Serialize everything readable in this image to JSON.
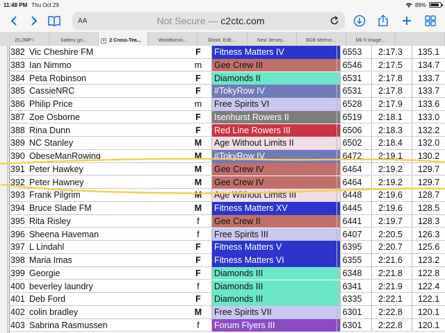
{
  "status_bar": {
    "time": "11:48 PM",
    "date": "Thu Oct 29",
    "battery": "89%",
    "battery_level": 0.89
  },
  "toolbar": {
    "aa_label": "AA",
    "not_secure": "Not Secure —",
    "domain": "c2ctc.com"
  },
  "tabs": [
    {
      "label": "20.2MP I",
      "active": false
    },
    {
      "label": "battery gri...",
      "active": false
    },
    {
      "label": "2 Cross-Tea...",
      "active": true
    },
    {
      "label": "Woodturnin...",
      "active": false
    },
    {
      "label": "Shoot, Edit,...",
      "active": false
    },
    {
      "label": "New Jersey...",
      "active": false
    },
    {
      "label": "8GB Memor...",
      "active": false
    },
    {
      "label": "Mk II Image...",
      "active": false
    },
    {
      "label": "",
      "active": false
    }
  ],
  "colors": {
    "blue": "#2b35cc",
    "rose": "#c0706a",
    "teal": "#6be6c8",
    "slate": "#6f7ab8",
    "lavender": "#c8c8f0",
    "gray": "#7d7d7d",
    "red": "#cc3344",
    "pink": "#f0dde6",
    "purple": "#8a4cc4",
    "highlight": "#f2cf52"
  },
  "results": [
    {
      "pos": "382",
      "name": "Vic Cheshire FM",
      "gender": "F",
      "club": "Fitness Matters IV",
      "club_color": "#2b35cc",
      "club_text": "#ffffff",
      "score": "6553",
      "time": "2:17.3",
      "split": "135.1"
    },
    {
      "pos": "383",
      "name": "Ian Nimmo",
      "gender": "m",
      "club": "Gee Crew III",
      "club_color": "#c0706a",
      "club_text": "#111111",
      "score": "6546",
      "time": "2:17.5",
      "split": "134.7"
    },
    {
      "pos": "384",
      "name": "Peta Robinson",
      "gender": "F",
      "club": "Diamonds II",
      "club_color": "#6be6c8",
      "club_text": "#111111",
      "score": "6531",
      "time": "2:17.8",
      "split": "133.7"
    },
    {
      "pos": "385",
      "name": "CassieNRC",
      "gender": "F",
      "club": "#TokyRow IV",
      "club_color": "#6f7ab8",
      "club_text": "#ffffff",
      "score": "6531",
      "time": "2:17.8",
      "split": "133.7"
    },
    {
      "pos": "386",
      "name": "Philip Price",
      "gender": "m",
      "club": "Free Spirits VI",
      "club_color": "#c8c8f0",
      "club_text": "#111111",
      "score": "6528",
      "time": "2:17.9",
      "split": "133.6"
    },
    {
      "pos": "387",
      "name": "Zoe Osborne",
      "gender": "F",
      "club": "Isenhurst Rowers II",
      "club_color": "#7d7d7d",
      "club_text": "#ffffff",
      "score": "6519",
      "time": "2:18.1",
      "split": "133.0"
    },
    {
      "pos": "388",
      "name": "Rina Dunn",
      "gender": "F",
      "club": "Red Line Rowers III",
      "club_color": "#cc3344",
      "club_text": "#ffffff",
      "score": "6506",
      "time": "2:18.3",
      "split": "132.2"
    },
    {
      "pos": "389",
      "name": "NC Stanley",
      "gender": "M",
      "club": "Age Without Limits II",
      "club_color": "#f0dde6",
      "club_text": "#111111",
      "score": "6502",
      "time": "2:18.4",
      "split": "132.0"
    },
    {
      "pos": "390",
      "name": "ObeseManRowing",
      "gender": "M",
      "club": "#TokyRow IV",
      "club_color": "#6f7ab8",
      "club_text": "#ffffff",
      "score": "6472",
      "time": "2:19.1",
      "split": "130.2"
    },
    {
      "pos": "391",
      "name": "Peter Hawkey",
      "gender": "M",
      "club": "Gee Crew IV",
      "club_color": "#c0706a",
      "club_text": "#111111",
      "score": "6464",
      "time": "2:19.2",
      "split": "129.7"
    },
    {
      "pos": "392",
      "name": "Peter Hawney",
      "gender": "M",
      "club": "Gee Crew IV",
      "club_color": "#c0706a",
      "club_text": "#111111",
      "score": "6464",
      "time": "2:19.2",
      "split": "129.7"
    },
    {
      "pos": "393",
      "name": "Frank Pilgrim",
      "gender": "M",
      "club": "Age Without Limits III",
      "club_color": "#f0dde6",
      "club_text": "#111111",
      "score": "6448",
      "time": "2:19.6",
      "split": "128.7"
    },
    {
      "pos": "394",
      "name": "Bruce Slade FM",
      "gender": "M",
      "club": "Fitness Matters XV",
      "club_color": "#2b35cc",
      "club_text": "#ffffff",
      "score": "6445",
      "time": "2:19.6",
      "split": "128.5"
    },
    {
      "pos": "395",
      "name": "Rita Risley",
      "gender": "f",
      "club": "Gee Crew II",
      "club_color": "#c0706a",
      "club_text": "#111111",
      "score": "6441",
      "time": "2:19.7",
      "split": "128.3"
    },
    {
      "pos": "396",
      "name": "Sheena Haveman",
      "gender": "f",
      "club": "Free Spirits III",
      "club_color": "#c8c8f0",
      "club_text": "#111111",
      "score": "6407",
      "time": "2:20.5",
      "split": "126.3"
    },
    {
      "pos": "397",
      "name": "L Lindahl",
      "gender": "F",
      "club": "Fitness Matters V",
      "club_color": "#2b35cc",
      "club_text": "#ffffff",
      "score": "6395",
      "time": "2:20.7",
      "split": "125.6"
    },
    {
      "pos": "398",
      "name": "Maria Imas",
      "gender": "F",
      "club": "Fitness Matters VI",
      "club_color": "#2b35cc",
      "club_text": "#ffffff",
      "score": "6355",
      "time": "2:21.6",
      "split": "123.2"
    },
    {
      "pos": "399",
      "name": "Georgie",
      "gender": "F",
      "club": "Diamonds III",
      "club_color": "#6be6c8",
      "club_text": "#111111",
      "score": "6348",
      "time": "2:21.8",
      "split": "122.8"
    },
    {
      "pos": "400",
      "name": "beverley laundry",
      "gender": "f",
      "club": "Diamonds III",
      "club_color": "#6be6c8",
      "club_text": "#111111",
      "score": "6341",
      "time": "2:21.9",
      "split": "122.4"
    },
    {
      "pos": "401",
      "name": "Deb Ford",
      "gender": "F",
      "club": "Diamonds III",
      "club_color": "#6be6c8",
      "club_text": "#111111",
      "score": "6335",
      "time": "2:22.1",
      "split": "122.1"
    },
    {
      "pos": "402",
      "name": "colin bradley",
      "gender": "M",
      "club": "Free Spirits VII",
      "club_color": "#c8c8f0",
      "club_text": "#111111",
      "score": "6301",
      "time": "2:22.8",
      "split": "120.1"
    },
    {
      "pos": "403",
      "name": "Sabrina Rasmussen",
      "gender": "f",
      "club": "Forum Flyers III",
      "club_color": "#8a4cc4",
      "club_text": "#ffffff",
      "score": "6301",
      "time": "2:22.8",
      "split": "120.1"
    }
  ]
}
